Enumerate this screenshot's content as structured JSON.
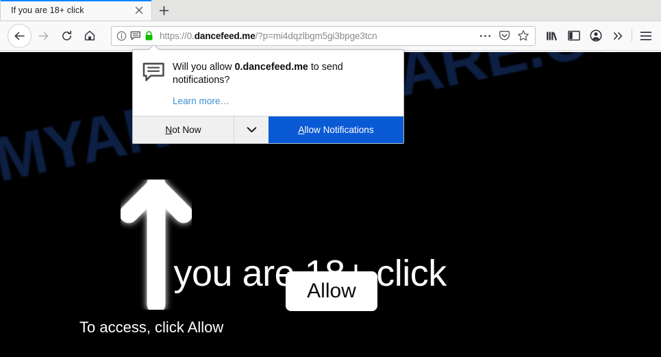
{
  "browser": {
    "tab": {
      "title": "If you are 18+ click",
      "close_icon": "close-icon"
    },
    "new_tab_icon": "plus-icon",
    "nav": {
      "back_icon": "arrow-left-icon",
      "forward_icon": "arrow-right-icon",
      "reload_icon": "reload-icon",
      "home_icon": "home-icon"
    },
    "urlbar": {
      "identity_icon": "info-circle-icon",
      "notification_icon": "speech-bubble-icon",
      "lock_icon": "padlock-icon",
      "lock_color": "#12bc00",
      "url_prefix": "https://0.",
      "url_domain": "dancefeed.me",
      "url_suffix": "/?p=mi4dqzlbgm5gi3bpge3tcn",
      "page_actions_icon": "ellipsis-icon",
      "pocket_icon": "pocket-icon",
      "bookmark_icon": "star-icon"
    },
    "toolbar_right": {
      "library_icon": "library-icon",
      "sidebar_icon": "sidebar-icon",
      "account_icon": "account-avatar-icon",
      "overflow_icon": "chevron-double-right-icon",
      "menu_icon": "hamburger-menu-icon"
    }
  },
  "doorhanger": {
    "icon": "speech-bubble-icon",
    "message_prefix": "Will you allow ",
    "message_origin": "0.dancefeed.me",
    "message_suffix": " to send notifications?",
    "learn_more": "Learn more…",
    "secondary_accesskey": "N",
    "secondary_label": "ot Now",
    "dropdown_icon": "chevron-down-icon",
    "primary_accesskey": "A",
    "primary_label": "llow Notifications",
    "primary_color": "#0a5ad5"
  },
  "page": {
    "background_color": "#000000",
    "watermark_text": "MYANTISPYWARE.COM",
    "watermark_color": "#0e2146",
    "arrow_icon": "arrow-up-icon",
    "headline": "If you are 18+ click",
    "allow_button_label": "Allow",
    "subtext": "To access, click Allow"
  }
}
